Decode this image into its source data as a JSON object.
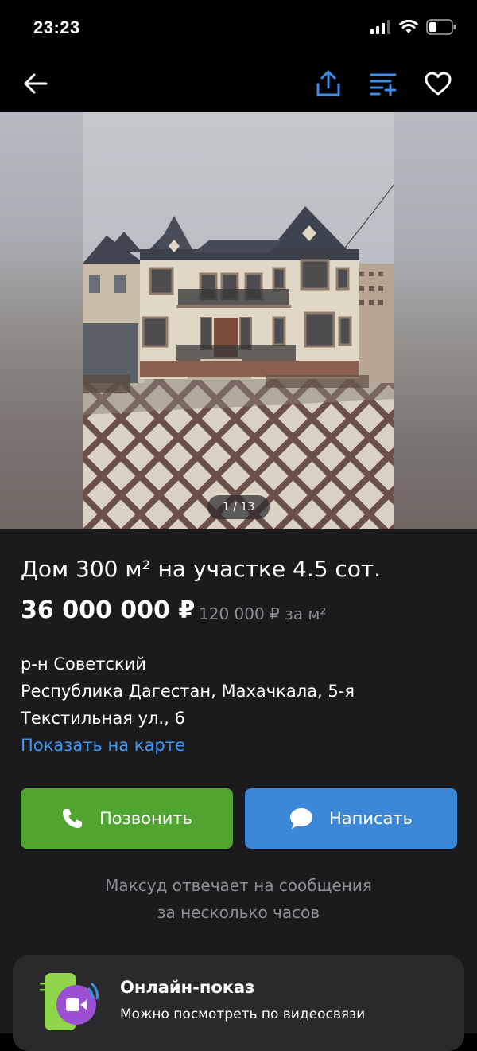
{
  "status": {
    "time": "23:23"
  },
  "nav": {
    "back_icon": "arrow-left-icon",
    "share_icon": "share-icon",
    "compare_icon": "compare-list-icon",
    "favorite_icon": "heart-icon"
  },
  "gallery": {
    "counter": "1 / 13"
  },
  "listing": {
    "title": "Дом 300 м² на участке 4.5 сот.",
    "price": "36 000 000 ₽",
    "price_per_m2": "120 000 ₽ за м²",
    "district": "р-н Советский",
    "address_line1": "Республика Дагестан, Махачкала, 5-я",
    "address_line2": "Текстильная ул., 6",
    "map_link": "Показать на карте"
  },
  "actions": {
    "call_label": "Позвонить",
    "write_label": "Написать",
    "call_color": "#4fa52f",
    "write_color": "#3d87d8"
  },
  "seller": {
    "reply_line1": "Максуд отвечает на сообщения",
    "reply_line2": "за несколько часов"
  },
  "online_show": {
    "title": "Онлайн-показ",
    "subtitle": "Можно посмотреть по видеосвязи"
  },
  "colors": {
    "link": "#3f96f0",
    "accent_icon": "#3d8ee6"
  }
}
